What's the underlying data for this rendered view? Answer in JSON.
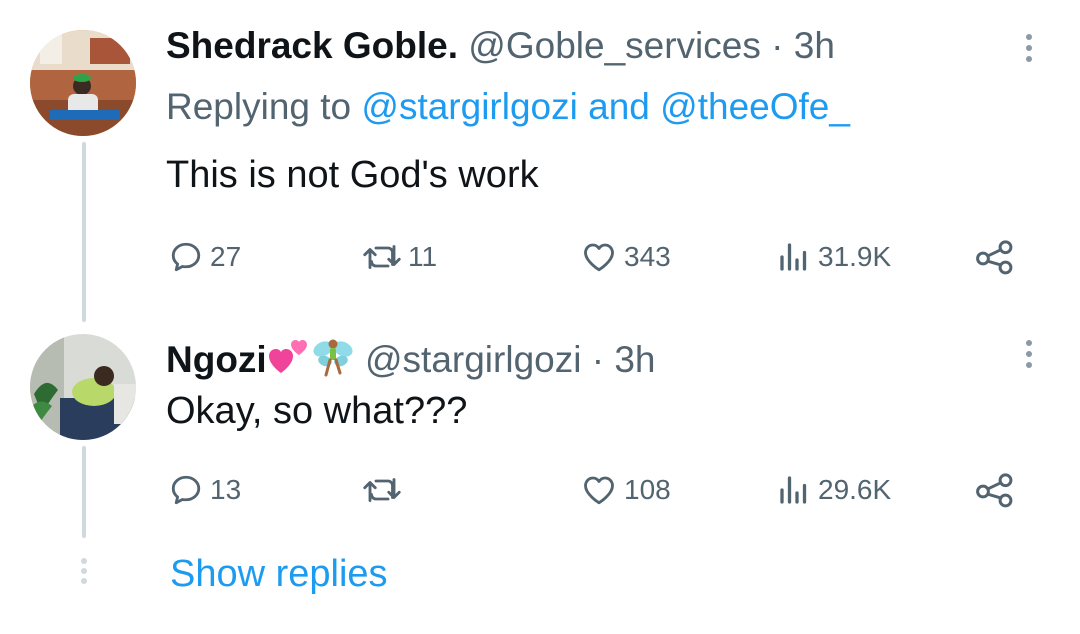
{
  "tweets": [
    {
      "name": "Shedrack Goble.",
      "handle": "@Goble_services",
      "separator": "·",
      "time": "3h",
      "replying_prefix": "Replying to",
      "replying_mention1": "@stargirlgozi",
      "replying_and": "and",
      "replying_mention2": "@theeOfe_",
      "text": "This is not God's work",
      "replies": "27",
      "retweets": "11",
      "likes": "343",
      "views": "31.9K"
    },
    {
      "name": "Ngozi",
      "handle": "@stargirlgozi",
      "separator": "·",
      "time": "3h",
      "text": "Okay, so what???",
      "replies": "13",
      "retweets": "",
      "likes": "108",
      "views": "29.6K"
    }
  ],
  "show_replies": "Show replies",
  "colors": {
    "accent": "#1d9bf0",
    "secondary_text": "#536471",
    "thread_line": "#cfd9de"
  },
  "icons": [
    "reply-icon",
    "retweet-icon",
    "like-icon",
    "views-icon",
    "share-icon",
    "more-icon",
    "two-hearts-emoji",
    "fairy-emoji"
  ]
}
